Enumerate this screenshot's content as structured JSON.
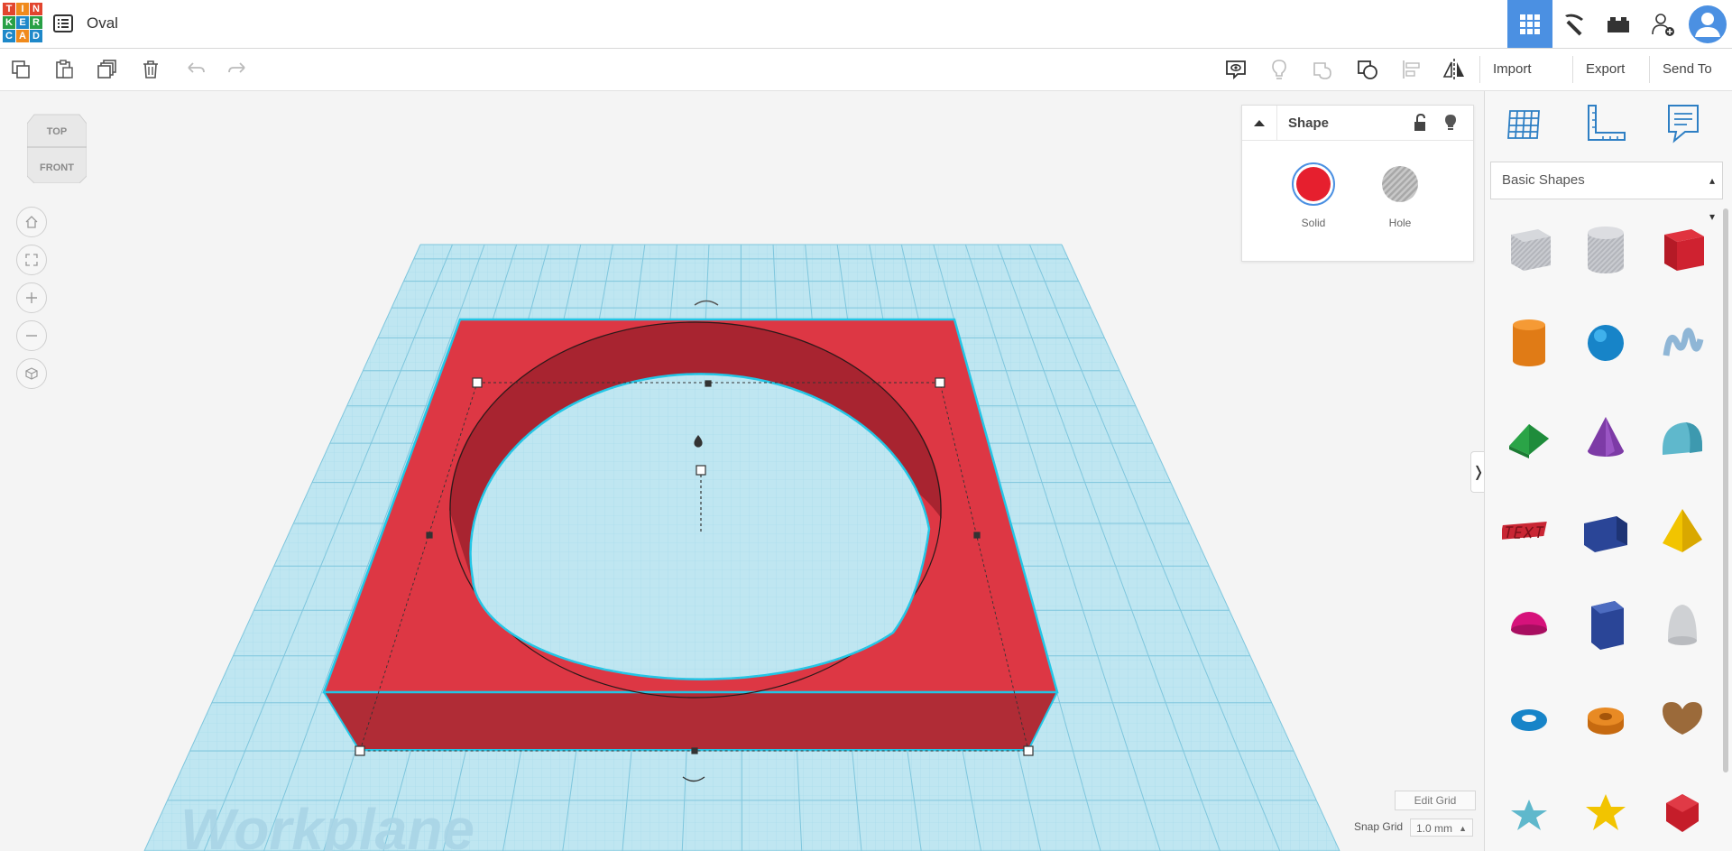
{
  "app": {
    "logo_letters": [
      "T",
      "I",
      "N",
      "K",
      "E",
      "R",
      "C",
      "A",
      "D"
    ],
    "design_title": "Oval"
  },
  "toolbar": {
    "import_label": "Import",
    "export_label": "Export",
    "send_to_label": "Send To"
  },
  "viewcube": {
    "top_label": "TOP",
    "front_label": "FRONT"
  },
  "workplane": {
    "watermark": "Workplane",
    "edit_grid_label": "Edit Grid",
    "snap_grid_label": "Snap Grid",
    "snap_grid_value": "1.0 mm"
  },
  "inspector": {
    "title": "Shape",
    "solid_label": "Solid",
    "hole_label": "Hole"
  },
  "panel": {
    "category": "Basic Shapes",
    "shapes": [
      "box-hole",
      "cylinder-hole",
      "box",
      "cylinder",
      "sphere",
      "scribble",
      "roof",
      "cone",
      "round-roof",
      "text",
      "wedge",
      "pyramid",
      "half-sphere",
      "polygon",
      "paraboloid",
      "torus",
      "tube",
      "heart",
      "star",
      "star-gold",
      "gem"
    ]
  },
  "colors": {
    "accent": "#4b90e2",
    "shape_red": "#dd3744",
    "grid_blue": "#a6dcea",
    "selection_cyan": "#22c6e6"
  }
}
